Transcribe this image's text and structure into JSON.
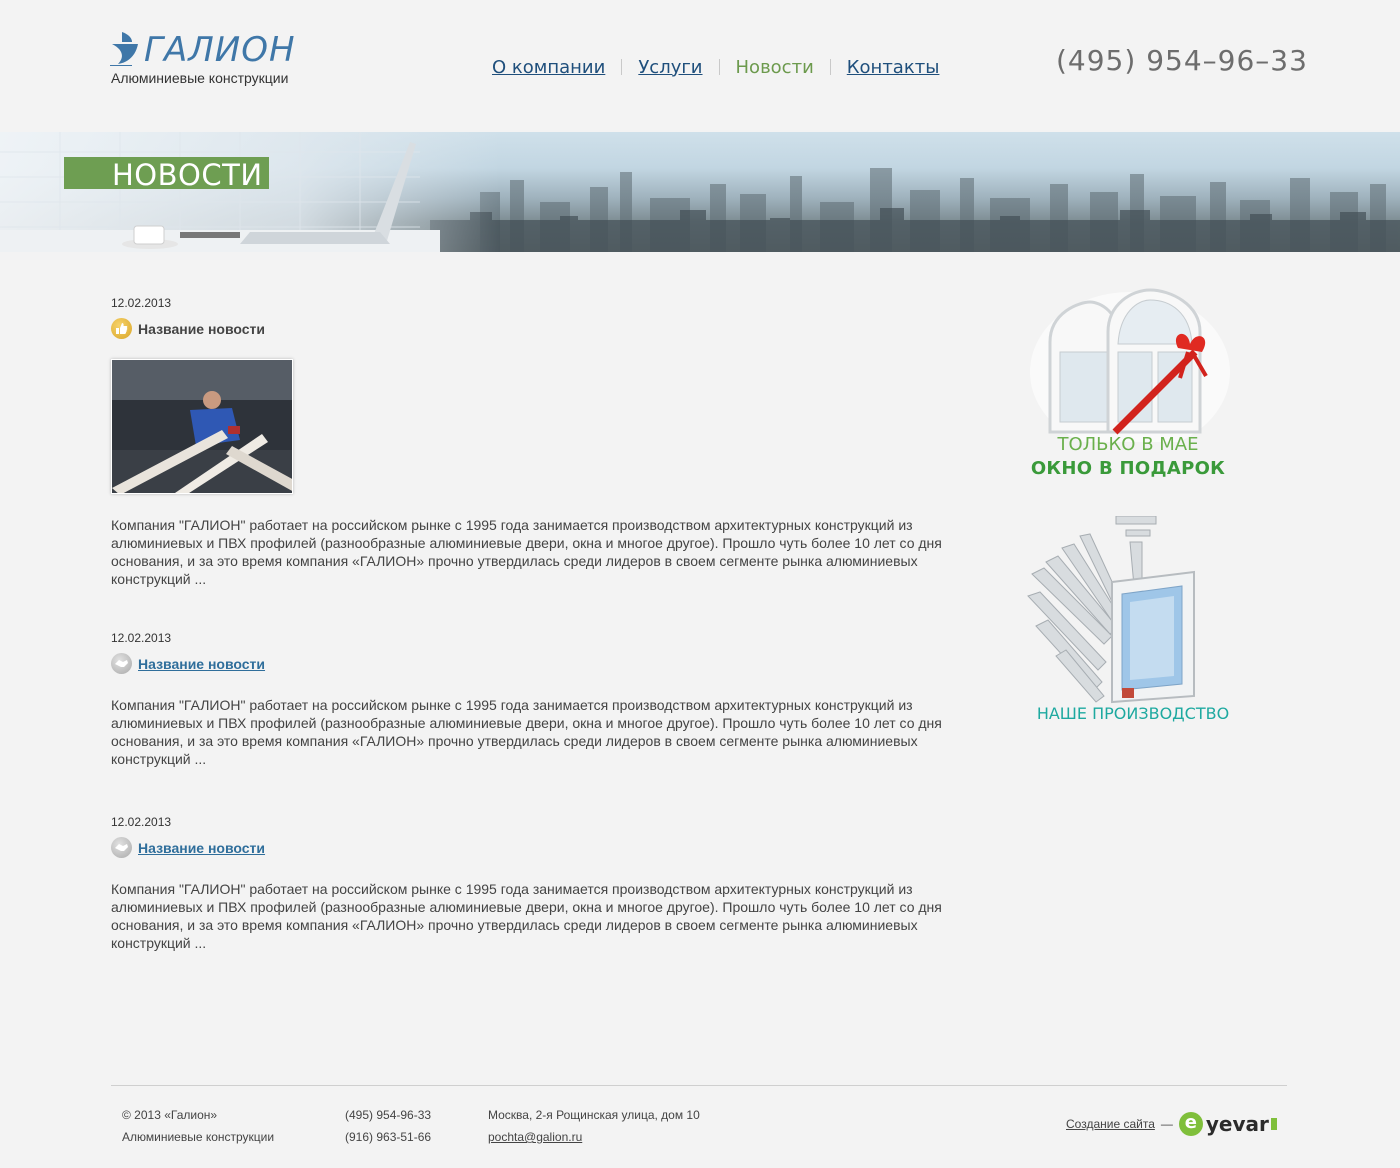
{
  "header": {
    "logo_name": "ГАЛИОН",
    "logo_subtitle": "Алюминиевые конструкции",
    "phone": "(495) 954–96–33",
    "nav": [
      {
        "label": "О компании",
        "active": false
      },
      {
        "label": "Услуги",
        "active": false
      },
      {
        "label": "Новости",
        "active": true
      },
      {
        "label": "Контакты",
        "active": false
      }
    ]
  },
  "banner": {
    "title": "НОВОСТИ"
  },
  "news": [
    {
      "date": "12.02.2013",
      "title": "Название новости",
      "icon": "thumbs-up-icon",
      "has_photo": true,
      "text": "Компания \"ГАЛИОН\" работает на российском рынке с 1995 года занимается производством архитектурных конструкций из алюминиевых и ПВХ профилей (разнообразные алюминиевые двери, окна и многое другое). Прошло чуть более 10 лет со дня основания, и за это время компания «ГАЛИОН» прочно утвердилась среди лидеров в своем сегменте рынка алюминиевых конструкций ..."
    },
    {
      "date": "12.02.2013",
      "title": "Название новости",
      "icon": "handshake-icon",
      "has_photo": false,
      "text": "Компания \"ГАЛИОН\" работает на российском рынке с 1995 года занимается производством архитектурных конструкций из алюминиевых и ПВХ профилей (разнообразные алюминиевые двери, окна и многое другое). Прошло чуть более 10 лет со дня основания, и за это время компания «ГАЛИОН» прочно утвердилась среди лидеров в своем сегменте рынка алюминиевых конструкций ..."
    },
    {
      "date": "12.02.2013",
      "title": "Название новости",
      "icon": "handshake-icon",
      "has_photo": false,
      "text": "Компания \"ГАЛИОН\" работает на российском рынке с 1995 года занимается производством архитектурных конструкций из алюминиевых и ПВХ профилей (разнообразные алюминиевые двери, окна и многое другое). Прошло чуть более 10 лет со дня основания, и за это время компания «ГАЛИОН» прочно утвердилась среди лидеров в своем сегменте рынка алюминиевых конструкций ..."
    }
  ],
  "sidebar": {
    "promo_gift_line1": "ТОЛЬКО В МАЕ",
    "promo_gift_line2": "ОКНО В ПОДАРОК",
    "promo_production": "НАШЕ ПРОИЗВОДСТВО"
  },
  "footer": {
    "copyright": "© 2013  «Галион»",
    "company": "Алюминиевые конструкции",
    "phone1": "(495) 954-96-33",
    "phone2": "(916) 963-51-66",
    "address": "Москва, 2-я Рощинская улица, дом 10",
    "email": "pochta@galion.ru",
    "dev_link": "Создание сайта",
    "dev_sep": "—",
    "dev_brand": "yevar"
  },
  "colors": {
    "accent_green": "#6e9e52",
    "link_blue": "#1f4f7c",
    "teal": "#1ea9a0"
  }
}
